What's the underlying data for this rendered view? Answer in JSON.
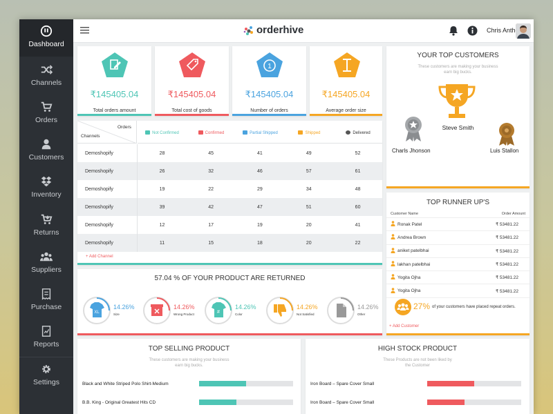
{
  "app": {
    "logo_text": "orderhive",
    "user_name": "Chris Anthony"
  },
  "sidebar": {
    "items": [
      {
        "label": "Dashboard",
        "icon": "dashboard-icon"
      },
      {
        "label": "Channels",
        "icon": "shuffle-icon"
      },
      {
        "label": "Orders",
        "icon": "cart-icon"
      },
      {
        "label": "Customers",
        "icon": "user-icon"
      },
      {
        "label": "Inventory",
        "icon": "dropbox-icon"
      },
      {
        "label": "Returns",
        "icon": "cart-return-icon"
      },
      {
        "label": "Suppliers",
        "icon": "users-icon"
      },
      {
        "label": "Purchase",
        "icon": "receipt-icon"
      },
      {
        "label": "Reports",
        "icon": "report-icon"
      },
      {
        "label": "Settings",
        "icon": "gear-icon"
      }
    ]
  },
  "stats": [
    {
      "value": "₹145405.04",
      "label": "Total orders amount",
      "color": "#4ec5b5"
    },
    {
      "value": "₹145405.04",
      "label": "Total cost of goods",
      "color": "#ef5a5e"
    },
    {
      "value": "₹145405.04",
      "label": "Number of orders",
      "color": "#4aa3df"
    },
    {
      "value": "₹145405.04",
      "label": "Average order size",
      "color": "#f5a623"
    }
  ],
  "orders_table": {
    "corner_orders": "Orders",
    "corner_channels": "Channels",
    "columns": [
      {
        "label": "Not Confirmed",
        "color": "#4ec5b5"
      },
      {
        "label": "Confirmed",
        "color": "#ef5a5e"
      },
      {
        "label": "Partial Shipped",
        "color": "#4aa3df"
      },
      {
        "label": "Shipped",
        "color": "#f5a623"
      },
      {
        "label": "Delivered",
        "color": "#555555"
      }
    ],
    "rows": [
      {
        "channel": "Demoshopify",
        "values": [
          "28",
          "45",
          "41",
          "49",
          "52"
        ]
      },
      {
        "channel": "Demoshopify",
        "values": [
          "26",
          "32",
          "46",
          "57",
          "61"
        ]
      },
      {
        "channel": "Demoshopify",
        "values": [
          "19",
          "22",
          "29",
          "34",
          "48"
        ]
      },
      {
        "channel": "Demoshopify",
        "values": [
          "39",
          "42",
          "47",
          "51",
          "60"
        ]
      },
      {
        "channel": "Demoshopify",
        "values": [
          "12",
          "17",
          "19",
          "20",
          "41"
        ]
      },
      {
        "channel": "Demoshopify",
        "values": [
          "11",
          "15",
          "18",
          "20",
          "22"
        ]
      }
    ],
    "add_label": "+ Add Channel"
  },
  "returns": {
    "title": "57.04 % OF YOUR PRODUCT ARE RETURNED",
    "items": [
      {
        "pct": "14.26%",
        "label": "Size",
        "color": "#4aa3df"
      },
      {
        "pct": "14.26%",
        "label": "Wrong Product",
        "color": "#ef5a5e"
      },
      {
        "pct": "14.26%",
        "label": "Color",
        "color": "#4ec5b5"
      },
      {
        "pct": "14.26%",
        "label": "Not Satisfied",
        "color": "#f5a623"
      },
      {
        "pct": "14.26%",
        "label": "Other",
        "color": "#999999"
      }
    ]
  },
  "top_customers": {
    "title": "YOUR TOP CUSTOMERS",
    "subtitle_line1": "These customers are making your business",
    "subtitle_line2": "earn big bucks.",
    "first": "Steve Smith",
    "second": "Charls Jhonson",
    "third": "Luis Stallon"
  },
  "runner_ups": {
    "title": "TOP RUNNER UP'S",
    "col_name": "Customer Name",
    "col_amount": "Order Amount",
    "rows": [
      {
        "name": "Ronak Patel",
        "amount": "₹ 53481.22"
      },
      {
        "name": "Andrea Brown",
        "amount": "₹ 53481.22"
      },
      {
        "name": "aniket patelbhai",
        "amount": "₹ 53481.22"
      },
      {
        "name": "lakhan patelbhai",
        "amount": "₹ 53481.22"
      },
      {
        "name": "Yogita Ojha",
        "amount": "₹ 53481.22"
      },
      {
        "name": "Yogita Ojha",
        "amount": "₹ 53481.22"
      }
    ],
    "repeat_pct": "27%",
    "repeat_text": "of your customers have placed repeat orders.",
    "add_label": "+ Add Customer"
  },
  "top_selling": {
    "title": "TOP SELLING PRODUCT",
    "subtitle_line1": "These customers are making your business",
    "subtitle_line2": "earn big bucks.",
    "items": [
      {
        "name": "Black and White Striped Polo Shirt-Medium",
        "fraction": 0.5
      },
      {
        "name": "B.B. King - Original Greatest Hits CD",
        "fraction": 0.4
      }
    ]
  },
  "high_stock": {
    "title": "HIGH STOCK PRODUCT",
    "subtitle_line1": "These Products are not been liked by",
    "subtitle_line2": "the Customer",
    "items": [
      {
        "name": "Iron Board – Spare Cover Small",
        "fraction": 0.5
      },
      {
        "name": "Iron Board – Spare Cover Small",
        "fraction": 0.4
      }
    ]
  },
  "colors": {
    "teal": "#4ec5b5",
    "red": "#ef5a5e",
    "blue": "#4aa3df",
    "orange": "#f5a623",
    "sidebar": "#2c3035"
  }
}
